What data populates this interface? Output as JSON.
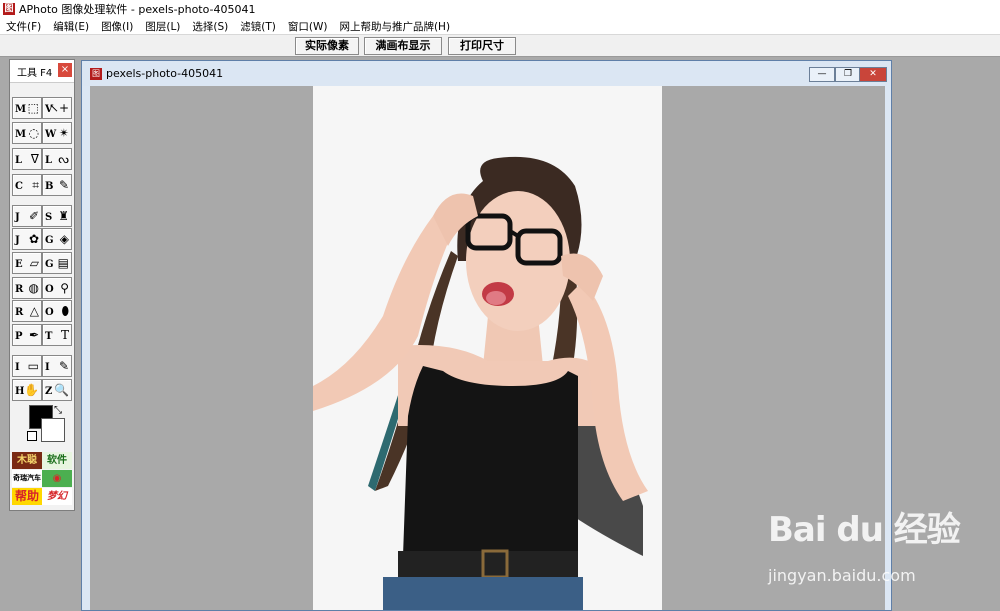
{
  "app": {
    "title": "APhoto 图像处理软件 - pexels-photo-405041",
    "logo_char": "图"
  },
  "menu": [
    "文件(F)",
    "编辑(E)",
    "图像(I)",
    "图层(L)",
    "选择(S)",
    "滤镜(T)",
    "窗口(W)",
    "网上帮助与推广品牌(H)"
  ],
  "toolbar": {
    "actual_pixels": "实际像素",
    "fit_canvas": "满画布显示",
    "print_size": "打印尺寸"
  },
  "palette": {
    "title": "工具 F4",
    "close": "×",
    "tools": [
      {
        "key": "M",
        "glyph": "⬚"
      },
      {
        "key": "V",
        "glyph": "↖+"
      },
      {
        "key": "M",
        "glyph": "◌"
      },
      {
        "key": "W",
        "glyph": "✴"
      },
      {
        "key": "L",
        "glyph": "ᐁ"
      },
      {
        "key": "L",
        "glyph": "ᔓ"
      },
      {
        "key": "C",
        "glyph": "⌗"
      },
      {
        "key": "B",
        "glyph": "✎"
      },
      {
        "key": "J",
        "glyph": "✐"
      },
      {
        "key": "S",
        "glyph": "♜"
      },
      {
        "key": "J",
        "glyph": "✿"
      },
      {
        "key": "G",
        "glyph": "◈"
      },
      {
        "key": "E",
        "glyph": "▱"
      },
      {
        "key": "G",
        "glyph": "▤"
      },
      {
        "key": "R",
        "glyph": "◍"
      },
      {
        "key": "O",
        "glyph": "⚲"
      },
      {
        "key": "R",
        "glyph": "△"
      },
      {
        "key": "O",
        "glyph": "⬮"
      },
      {
        "key": "P",
        "glyph": "✒"
      },
      {
        "key": "T",
        "glyph": "T"
      },
      {
        "key": "I",
        "glyph": "▭"
      },
      {
        "key": "I",
        "glyph": "✎"
      },
      {
        "key": "H",
        "glyph": "✋"
      },
      {
        "key": "Z",
        "glyph": "🔍"
      }
    ],
    "ads": [
      "木聪",
      "软件",
      "奇瑞汽车",
      "◉",
      "帮助",
      "梦幻"
    ],
    "colors": {
      "foreground": "#000000",
      "background": "#ffffff"
    }
  },
  "document": {
    "title": "pexels-photo-405041",
    "minimize": "—",
    "restore": "❐",
    "close": "✕"
  },
  "watermark": {
    "logo": "Bai du 经验",
    "url": "jingyan.baidu.com"
  }
}
